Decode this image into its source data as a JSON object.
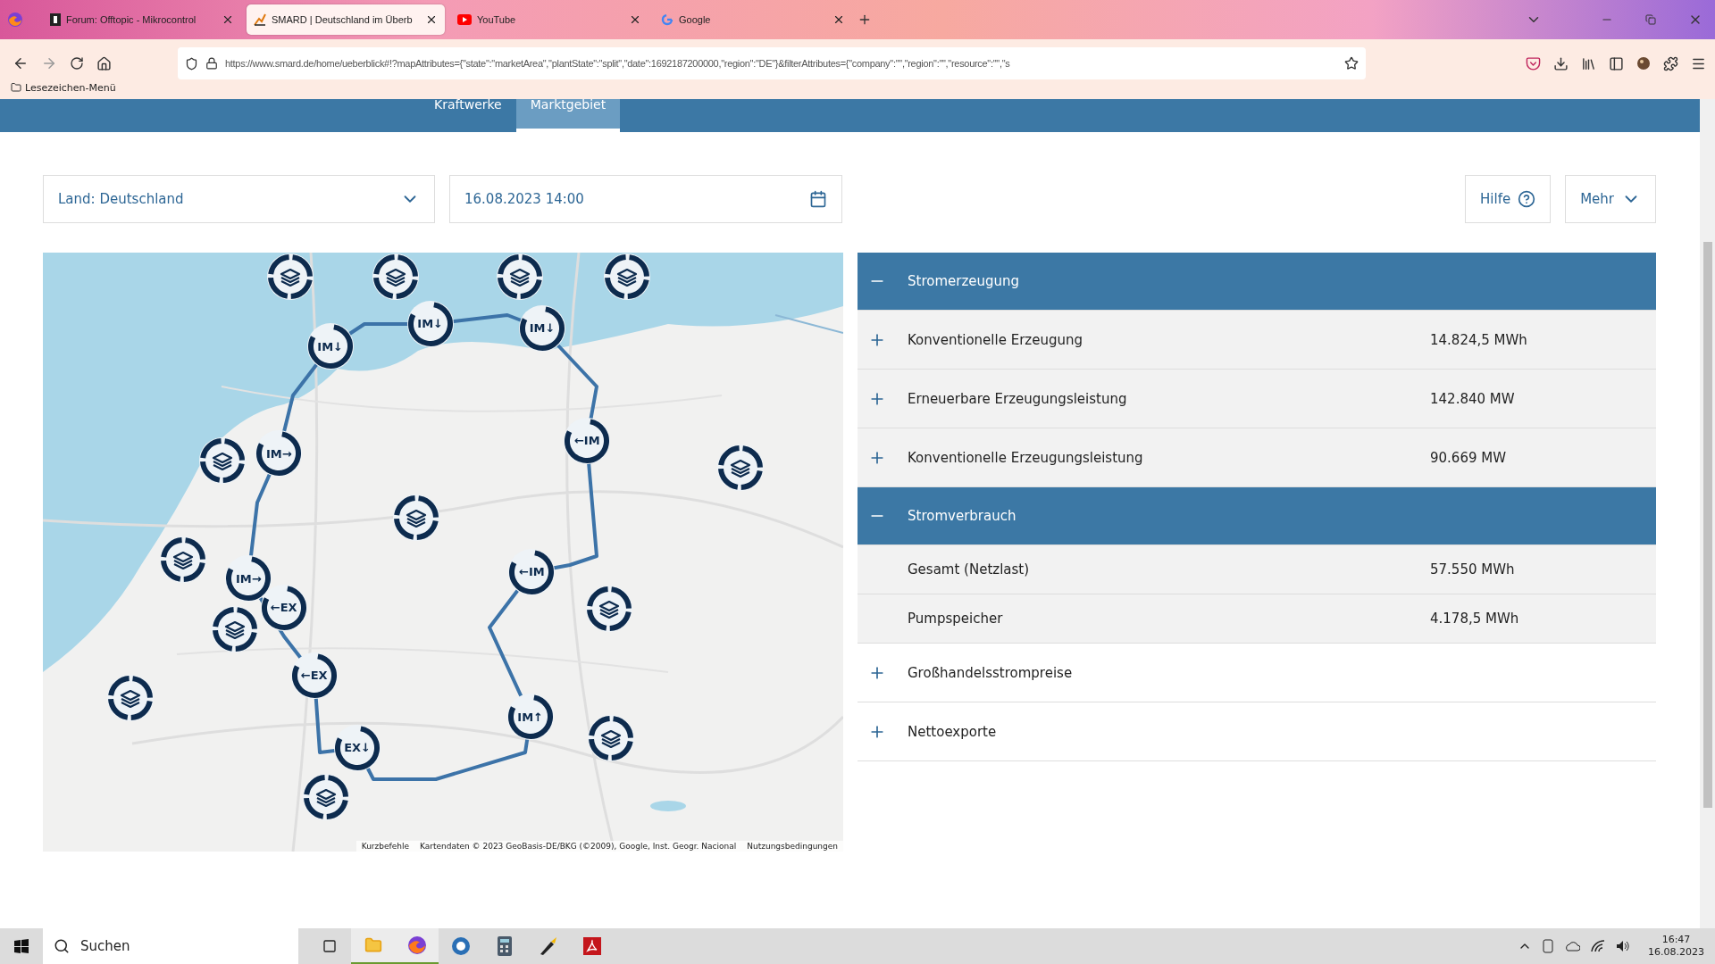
{
  "browser": {
    "tabs": [
      {
        "title": "Forum: Offtopic - Mikrocontrol",
        "selected": false,
        "kind": "forum"
      },
      {
        "title": "SMARD | Deutschland im Überb",
        "selected": true,
        "kind": "smard"
      },
      {
        "title": "YouTube",
        "selected": false,
        "kind": "youtube"
      },
      {
        "title": "Google",
        "selected": false,
        "kind": "google"
      }
    ],
    "url": "https://www.smard.de/home/ueberblick#!?mapAttributes={\"state\":\"marketArea\",\"plantState\":\"split\",\"date\":1692187200000,\"region\":\"DE\"}&filterAttributes={\"company\":\"\",\"region\":\"\",\"resource\":\"\",\"s",
    "bookmark": "Lesezeichen-Menü"
  },
  "nav": [
    {
      "label": "Kraftwerke",
      "selected": false
    },
    {
      "label": "Marktgebiet",
      "selected": true
    }
  ],
  "filters": {
    "country": "Land: Deutschland",
    "date": "16.08.2023 14:00",
    "help": "Hilfe",
    "more": "Mehr"
  },
  "map": {
    "kind": "picture",
    "markers": [
      {
        "kind": "storage"
      },
      {
        "kind": "storage"
      },
      {
        "kind": "storage"
      },
      {
        "kind": "storage"
      },
      {
        "kind": "flow",
        "label": "IM↓"
      },
      {
        "kind": "flow",
        "label": "IM↓"
      },
      {
        "kind": "flow",
        "label": "IM↓"
      },
      {
        "kind": "flow",
        "label": "IM→"
      },
      {
        "kind": "flow",
        "label": "←IM"
      },
      {
        "kind": "storage"
      },
      {
        "kind": "storage"
      },
      {
        "kind": "storage"
      },
      {
        "kind": "storage"
      },
      {
        "kind": "flow",
        "label": "←IM"
      },
      {
        "kind": "flow",
        "label": "IM→"
      },
      {
        "kind": "flow",
        "label": "←EX"
      },
      {
        "kind": "storage"
      },
      {
        "kind": "storage"
      },
      {
        "kind": "flow",
        "label": "←EX"
      },
      {
        "kind": "storage"
      },
      {
        "kind": "flow",
        "label": "IM↑"
      },
      {
        "kind": "storage"
      },
      {
        "kind": "flow",
        "label": "EX↓"
      },
      {
        "kind": "storage"
      }
    ],
    "attribution": [
      "Kurzbefehle",
      "Kartendaten © 2023 GeoBasis-DE/BKG (©2009), Google, Inst. Geogr. Nacional",
      "Nutzungsbedingungen"
    ]
  },
  "sections": [
    {
      "title": "Stromerzeugung",
      "expanded": true,
      "children": [
        {
          "title": "Konventionelle Erzeugung",
          "value": "14.824,5 MWh",
          "expanded": false
        },
        {
          "title": "Erneuerbare Erzeugungsleistung",
          "value": "142.840 MW",
          "expanded": false
        },
        {
          "title": "Konventionelle Erzeugungsleistung",
          "value": "90.669 MW",
          "expanded": false
        }
      ]
    },
    {
      "title": "Stromverbrauch",
      "expanded": true,
      "children": [
        {
          "title": "Gesamt (Netzlast)",
          "value": "57.550 MWh"
        },
        {
          "title": "Pumpspeicher",
          "value": "4.178,5 MWh"
        }
      ]
    },
    {
      "title": "Großhandelsstrompreise",
      "expanded": false
    },
    {
      "title": "Nettoexporte",
      "expanded": false
    }
  ],
  "taskbar": {
    "search": "Suchen",
    "time": "16:47",
    "date": "16.08.2023"
  }
}
